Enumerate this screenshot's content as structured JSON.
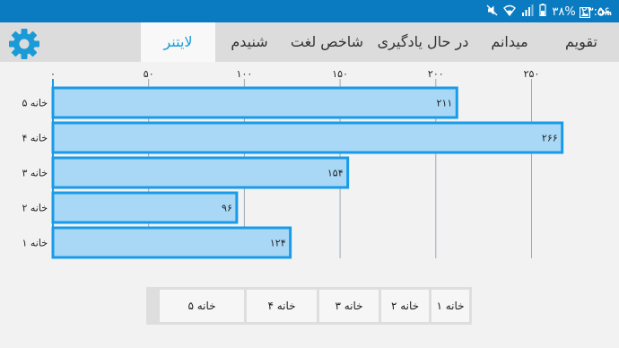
{
  "statusbar": {
    "time": "۲۳:۵۶",
    "battery": "۳۸%",
    "icons": [
      "battery-icon",
      "signal-icon",
      "wifi-icon",
      "mute-icon",
      "image-icon",
      "key-icon"
    ]
  },
  "appbar": {
    "settings_icon": "gear-icon",
    "tabs": [
      {
        "label": "تقویم"
      },
      {
        "label": "میدانم"
      },
      {
        "label": "در حال یادگیری"
      },
      {
        "label": "شاخص لغت"
      },
      {
        "label": "شنیدم"
      },
      {
        "label": "لایتنر"
      }
    ],
    "active_tab": "لایتنر"
  },
  "colors": {
    "accent": "#1a9bd7",
    "statusbar": "#0a7bc0",
    "bar_fill": "#a9d8f7",
    "bar_stroke": "#1a9be8"
  },
  "chart_data": {
    "type": "bar",
    "orientation": "horizontal",
    "categories": [
      "خانه ۵",
      "خانه ۴",
      "خانه ۳",
      "خانه ۲",
      "خانه ۱"
    ],
    "values": [
      211,
      266,
      154,
      96,
      124
    ],
    "value_labels": [
      "۲۱۱",
      "۲۶۶",
      "۱۵۴",
      "۹۶",
      "۱۲۴"
    ],
    "xticks": [
      0,
      50,
      100,
      150,
      200,
      250
    ],
    "xtick_labels": [
      "۰",
      "۵۰",
      "۱۰۰",
      "۱۵۰",
      "۲۰۰",
      "۲۵۰"
    ],
    "xlim": [
      0,
      280
    ],
    "grid": true
  },
  "legend": {
    "items": [
      {
        "label": "خانه ۱"
      },
      {
        "label": "خانه ۲"
      },
      {
        "label": "خانه ۳"
      },
      {
        "label": "خانه ۴"
      },
      {
        "label": "خانه ۵"
      }
    ]
  }
}
